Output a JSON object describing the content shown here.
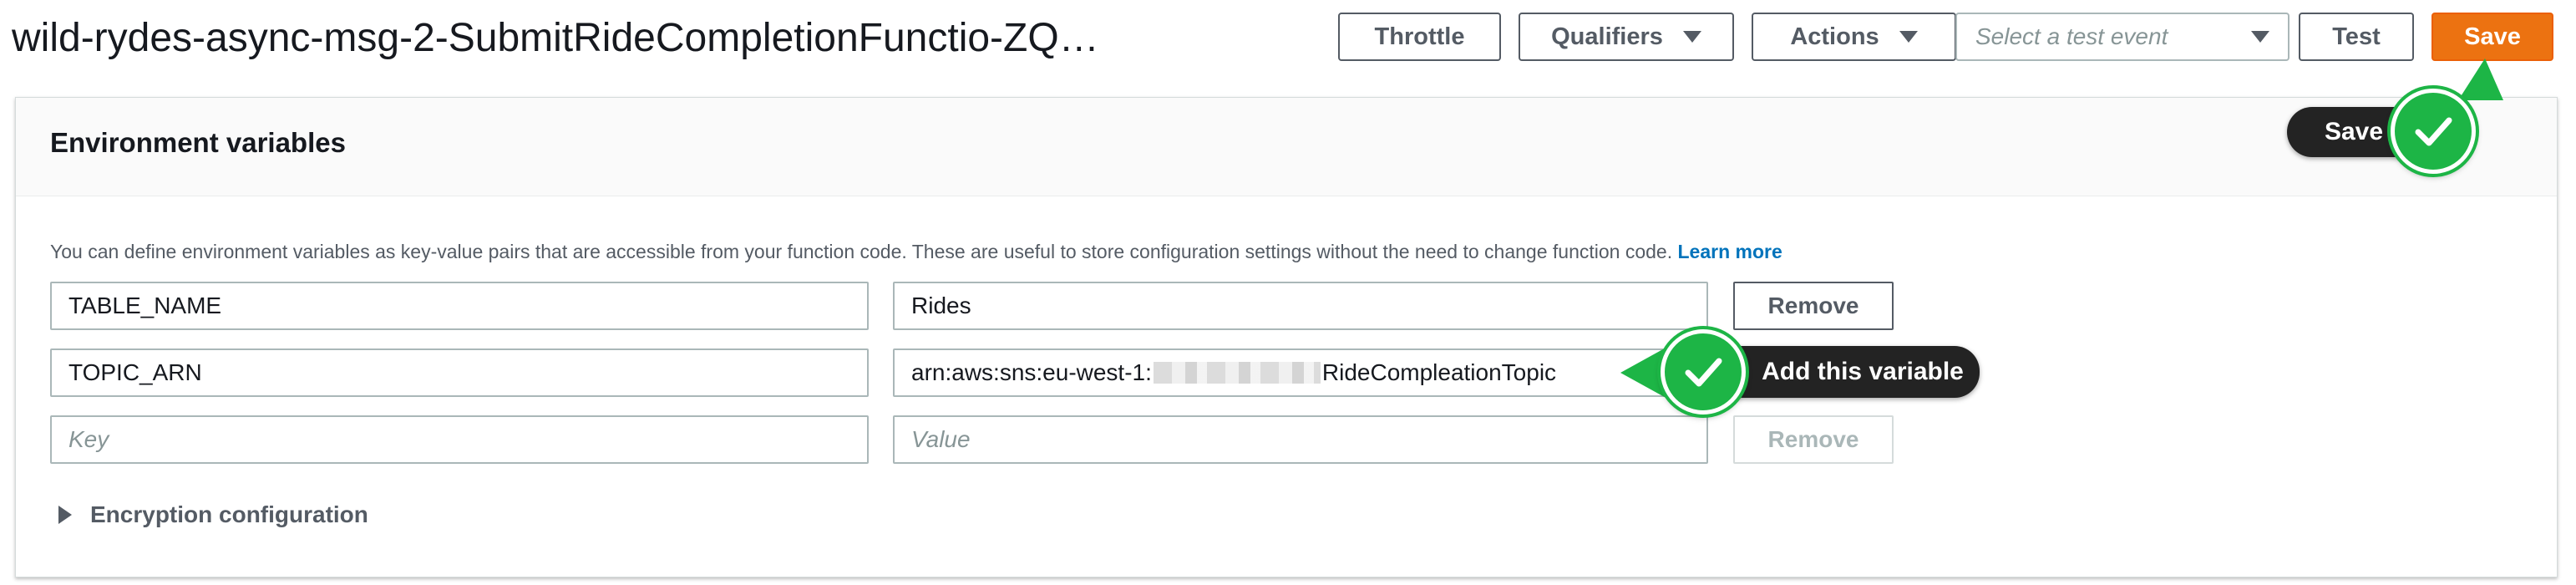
{
  "header": {
    "function_title": "wild-rydes-async-msg-2-SubmitRideCompletionFunctio-ZQ…",
    "throttle_label": "Throttle",
    "qualifiers_label": "Qualifiers",
    "actions_label": "Actions",
    "test_event_placeholder": "Select a test event",
    "test_label": "Test",
    "save_label": "Save"
  },
  "env_panel": {
    "title": "Environment variables",
    "description": "You can define environment variables as key-value pairs that are accessible from your function code. These are useful to store configuration settings without the need to change function code.",
    "learn_more": "Learn more",
    "rows": [
      {
        "key": "TABLE_NAME",
        "value": "Rides",
        "remove_label": "Remove"
      },
      {
        "key": "TOPIC_ARN",
        "value_prefix": "arn:aws:sns:eu-west-1:",
        "value_suffix": "RideCompleationTopic",
        "remove_label": "Remove"
      },
      {
        "key_placeholder": "Key",
        "value_placeholder": "Value",
        "remove_label": "Remove"
      }
    ],
    "encryption_label": "Encryption configuration"
  },
  "annotations": {
    "save_callout": "Save",
    "add_variable_callout": "Add this variable"
  },
  "colors": {
    "primary": "#ec7211",
    "link": "#0073bb",
    "callout_green": "#1db546",
    "callout_dark": "#232323"
  }
}
